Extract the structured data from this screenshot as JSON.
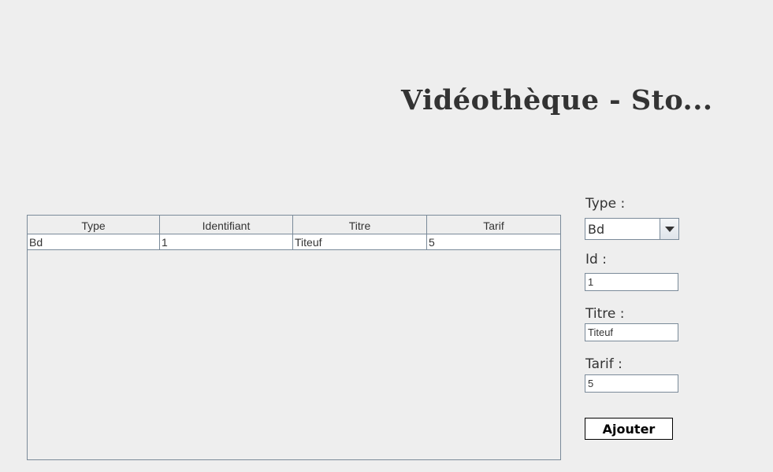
{
  "app": {
    "title": "Vidéothèque - Sto..."
  },
  "table": {
    "columns": [
      "Type",
      "Identifiant",
      "Titre",
      "Tarif"
    ],
    "rows": [
      [
        "Bd",
        "1",
        "Titeuf",
        "5"
      ]
    ]
  },
  "form": {
    "type_label": "Type :",
    "type_value": "Bd",
    "id_label": "Id :",
    "id_value": "1",
    "titre_label": "Titre :",
    "titre_value": "Titeuf",
    "tarif_label": "Tarif :",
    "tarif_value": "5",
    "submit_label": "Ajouter"
  }
}
